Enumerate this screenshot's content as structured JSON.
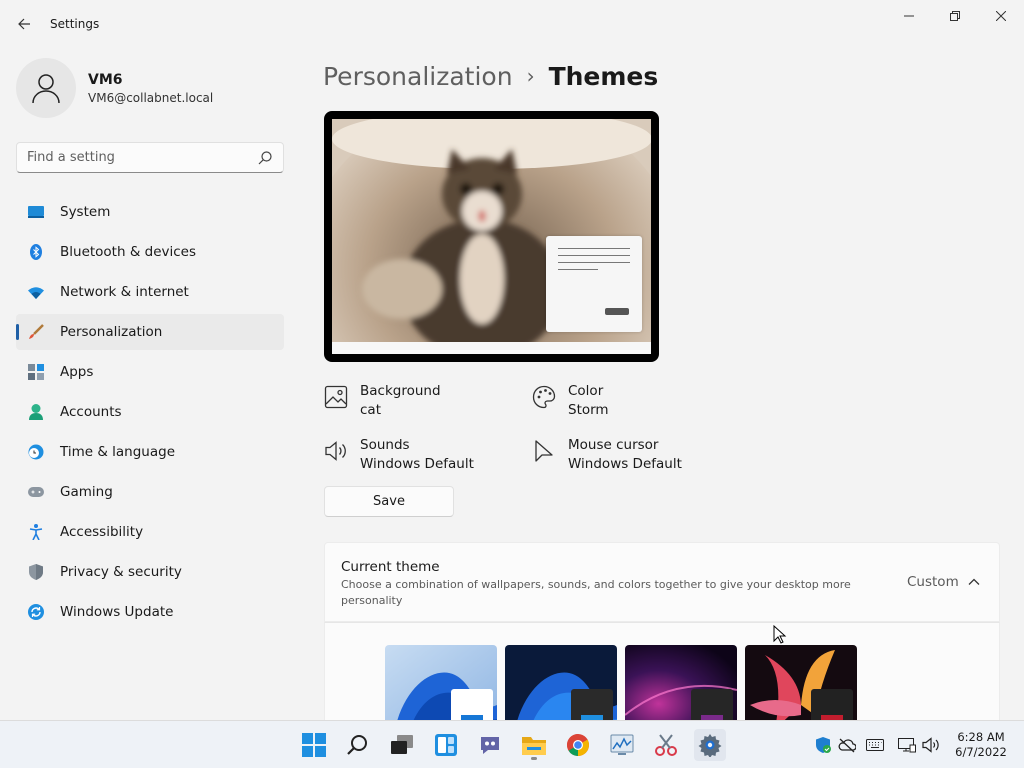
{
  "window": {
    "app_title": "Settings",
    "controls": {
      "minimize": "minimize-icon",
      "maximize": "restore-icon",
      "close": "close-icon"
    }
  },
  "profile": {
    "name": "VM6",
    "email": "VM6@collabnet.local"
  },
  "search": {
    "placeholder": "Find a setting",
    "value": ""
  },
  "nav": {
    "items": [
      {
        "label": "System",
        "icon": "system-icon"
      },
      {
        "label": "Bluetooth & devices",
        "icon": "bluetooth-icon"
      },
      {
        "label": "Network & internet",
        "icon": "wifi-icon"
      },
      {
        "label": "Personalization",
        "icon": "brush-icon",
        "active": true
      },
      {
        "label": "Apps",
        "icon": "apps-icon"
      },
      {
        "label": "Accounts",
        "icon": "accounts-icon"
      },
      {
        "label": "Time & language",
        "icon": "clock-globe-icon"
      },
      {
        "label": "Gaming",
        "icon": "gamepad-icon"
      },
      {
        "label": "Accessibility",
        "icon": "accessibility-icon"
      },
      {
        "label": "Privacy & security",
        "icon": "shield-icon"
      },
      {
        "label": "Windows Update",
        "icon": "update-icon"
      }
    ]
  },
  "breadcrumb": {
    "parent": "Personalization",
    "separator": "›",
    "current": "Themes"
  },
  "theme_props": {
    "background": {
      "title": "Background",
      "value": "cat"
    },
    "color": {
      "title": "Color",
      "value": "Storm"
    },
    "sounds": {
      "title": "Sounds",
      "value": "Windows Default"
    },
    "mouse_cursor": {
      "title": "Mouse cursor",
      "value": "Windows Default"
    }
  },
  "save_label": "Save",
  "current_theme": {
    "title": "Current theme",
    "description": "Choose a combination of wallpapers, sounds, and colors together to give your desktop more personality",
    "value": "Custom"
  },
  "theme_thumbnails": [
    {
      "name": "windows-light-theme"
    },
    {
      "name": "windows-dark-theme"
    },
    {
      "name": "glow-theme"
    },
    {
      "name": "captured-motion-theme"
    }
  ],
  "taskbar": {
    "clock_time": "6:28 AM",
    "clock_date": "6/7/2022"
  },
  "colors": {
    "accent": "#1f5fa6",
    "background": "#f3f3f3",
    "card": "#fbfbfb"
  }
}
